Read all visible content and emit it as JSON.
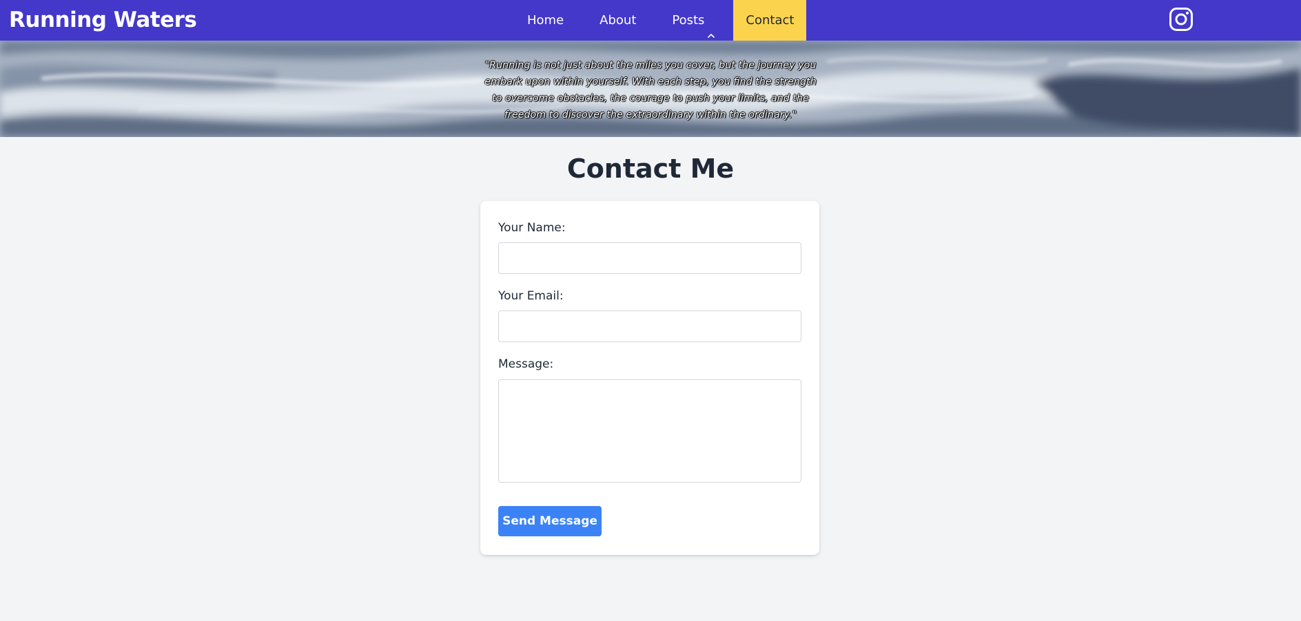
{
  "brand": {
    "title": "Running Waters"
  },
  "nav": {
    "items": [
      {
        "label": "Home",
        "active": false
      },
      {
        "label": "About",
        "active": false
      },
      {
        "label": "Posts",
        "active": false,
        "icon": "chevron-up-icon"
      },
      {
        "label": "Contact",
        "active": true
      }
    ],
    "social_icon": "instagram-icon"
  },
  "hero": {
    "quote": "\"Running is not just about the miles you cover, but the journey you embark upon within yourself. With each step, you find the strength to overcome obstacles, the courage to push your limits, and the freedom to discover the extraordinary within the ordinary.\""
  },
  "contact": {
    "title": "Contact Me",
    "name_label": "Your Name:",
    "name_value": "",
    "email_label": "Your Email:",
    "email_value": "",
    "message_label": "Message:",
    "message_value": "",
    "submit_label": "Send Message"
  },
  "colors": {
    "navbar": "#4338ca",
    "active_tab": "#fcd34d",
    "button": "#3b82f6",
    "page_bg": "#f3f4f6",
    "text": "#1f2937"
  }
}
